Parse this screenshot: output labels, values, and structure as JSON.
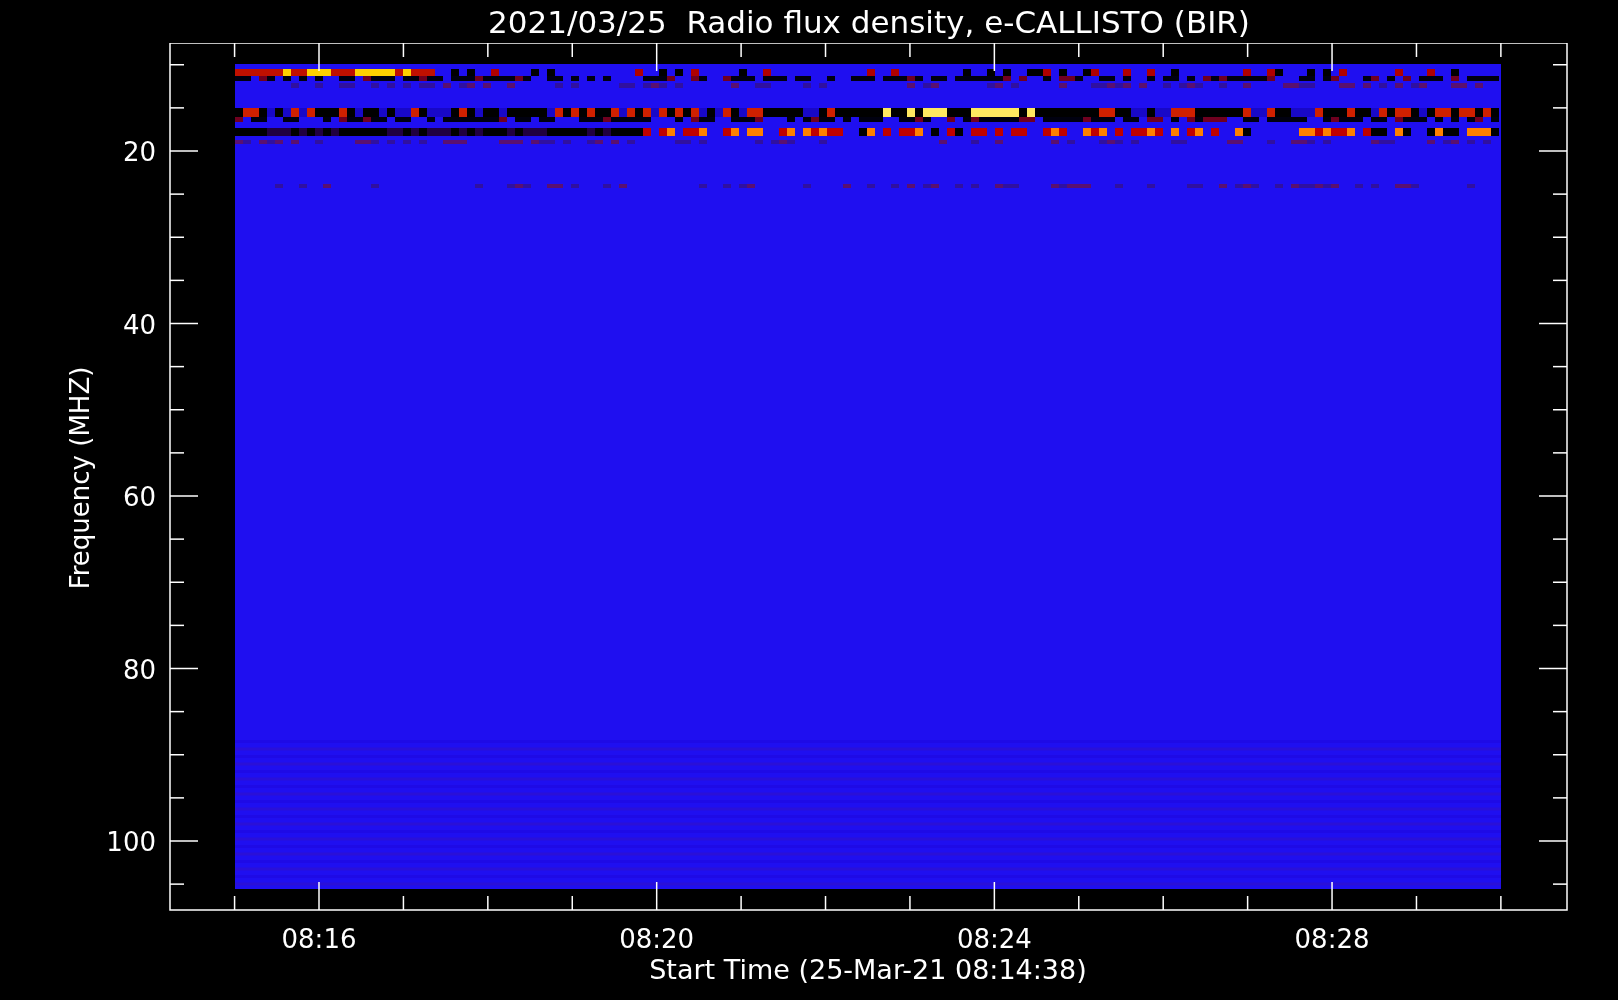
{
  "chart": {
    "title": "2021/03/25  Radio flux density, e-CALLISTO (BIR)",
    "xlabel": "Start Time (25-Mar-21 08:14:38)",
    "ylabel": "Frequency (MHZ)",
    "yticks": [
      "20",
      "40",
      "60",
      "80",
      "100"
    ],
    "xticks": [
      "08:16",
      "08:20",
      "08:24",
      "08:28"
    ]
  }
}
